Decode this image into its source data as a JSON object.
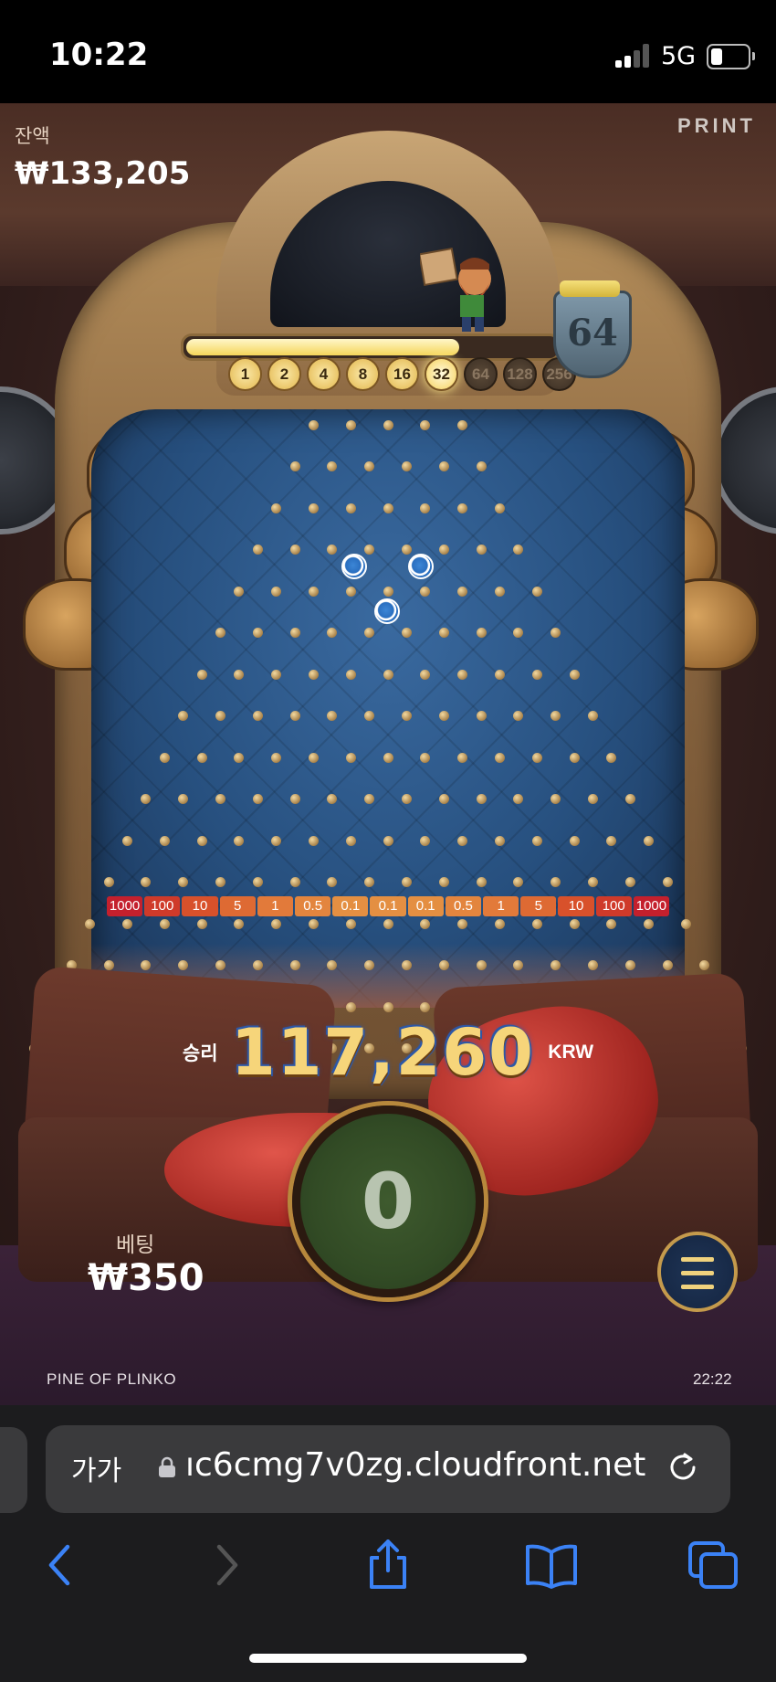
{
  "status_bar": {
    "time": "10:22",
    "network": "5G"
  },
  "game": {
    "logo": "PRINT",
    "balance_label": "잔액",
    "balance_value": "₩133,205",
    "progress_fraction": 0.74,
    "progress_steps": [
      {
        "label": "1",
        "state": "lit"
      },
      {
        "label": "2",
        "state": "lit"
      },
      {
        "label": "4",
        "state": "lit"
      },
      {
        "label": "8",
        "state": "lit"
      },
      {
        "label": "16",
        "state": "lit"
      },
      {
        "label": "32",
        "state": "active"
      },
      {
        "label": "64",
        "state": "dim"
      },
      {
        "label": "128",
        "state": "dim"
      },
      {
        "label": "256",
        "state": "dim"
      }
    ],
    "bucket_multiplier": "64",
    "bins": [
      {
        "label": "1000",
        "color": "#c4202d"
      },
      {
        "label": "100",
        "color": "#cf3a2a"
      },
      {
        "label": "10",
        "color": "#d8512b"
      },
      {
        "label": "5",
        "color": "#de6a33"
      },
      {
        "label": "1",
        "color": "#e27a3a"
      },
      {
        "label": "0.5",
        "color": "#e3853e"
      },
      {
        "label": "0.1",
        "color": "#e48f42"
      },
      {
        "label": "0.1",
        "color": "#e48f42"
      },
      {
        "label": "0.1",
        "color": "#e48f42"
      },
      {
        "label": "0.5",
        "color": "#e3853e"
      },
      {
        "label": "1",
        "color": "#e27a3a"
      },
      {
        "label": "5",
        "color": "#de6a33"
      },
      {
        "label": "10",
        "color": "#d8512b"
      },
      {
        "label": "100",
        "color": "#cf3a2a"
      },
      {
        "label": "1000",
        "color": "#c4202d"
      }
    ],
    "win_label": "승리",
    "win_amount": "117,260",
    "win_unit": "KRW",
    "spin_count": "0",
    "bet_label": "베팅",
    "bet_value": "₩350",
    "game_name": "PINE OF PLINKO",
    "clock": "22:22"
  },
  "browser": {
    "aa_label": "가가",
    "url": "ıc6cmg7v0zg.cloudfront.net",
    "icons": [
      "back-icon",
      "forward-icon",
      "share-icon",
      "bookmarks-icon",
      "tabs-icon"
    ]
  }
}
